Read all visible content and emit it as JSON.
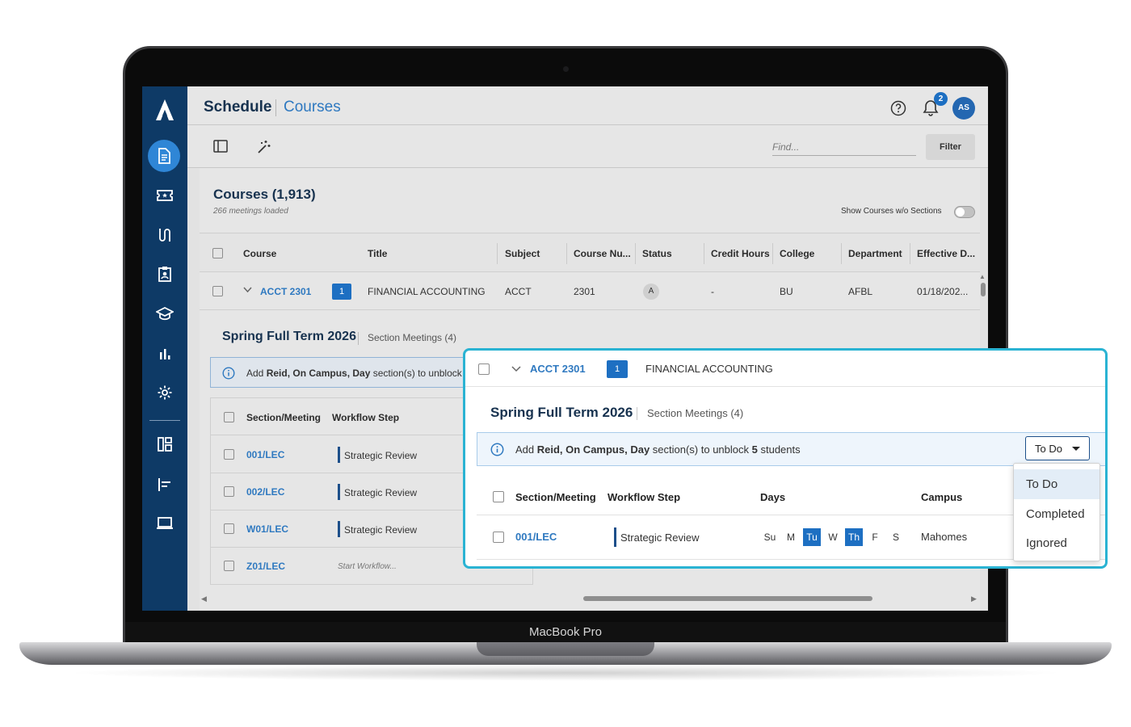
{
  "device": {
    "label": "MacBook Pro"
  },
  "header": {
    "section": "Schedule",
    "page": "Courses",
    "notification_count": "2",
    "avatar_initials": "AS"
  },
  "toolbar": {
    "find_placeholder": "Find...",
    "filter_label": "Filter"
  },
  "courses": {
    "title": "Courses (1,913)",
    "meetings_loaded": "266 meetings loaded",
    "show_without_sections_label": "Show Courses w/o Sections",
    "show_without_sections": false
  },
  "grid": {
    "columns": [
      "Course",
      "Title",
      "Subject",
      "Course Nu...",
      "Status",
      "Credit Hours",
      "College",
      "Department",
      "Effective D..."
    ],
    "row": {
      "course": "ACCT 2301",
      "sections_count": "1",
      "title": "FINANCIAL ACCOUNTING",
      "subject": "ACCT",
      "course_number": "2301",
      "status": "A",
      "credit_hours": "-",
      "college": "BU",
      "department": "AFBL",
      "effective_date": "01/18/202..."
    }
  },
  "term": {
    "name": "Spring Full Term 2026",
    "meetings": "Section Meetings (4)"
  },
  "alert": {
    "prefix": "Add ",
    "bold": "Reid, On Campus, Day",
    "middle": " section(s) to unblock ",
    "count": "5",
    "suffix": " students",
    "truncated": " section(s) to unblock"
  },
  "sections": {
    "columns": [
      "Section/Meeting",
      "Workflow Step",
      "Days",
      "Campus"
    ],
    "rows": [
      {
        "section": "001/LEC",
        "step": "Strategic Review"
      },
      {
        "section": "002/LEC",
        "step": "Strategic Review"
      },
      {
        "section": "W01/LEC",
        "step": "Strategic Review"
      },
      {
        "section": "Z01/LEC",
        "step": "Start Workflow..."
      }
    ]
  },
  "zoom": {
    "days": [
      {
        "label": "Su",
        "on": false
      },
      {
        "label": "M",
        "on": false
      },
      {
        "label": "Tu",
        "on": true
      },
      {
        "label": "W",
        "on": false
      },
      {
        "label": "Th",
        "on": true
      },
      {
        "label": "F",
        "on": false
      },
      {
        "label": "S",
        "on": false
      }
    ],
    "campus": "Mahomes"
  },
  "status_dropdown": {
    "selected": "To Do",
    "options": [
      "To Do",
      "Completed",
      "Ignored"
    ]
  },
  "colors": {
    "sidebar": "#0e3a66",
    "accent": "#1d6fc2",
    "link": "#2f79c0",
    "callout_border": "#2ab3d3"
  }
}
